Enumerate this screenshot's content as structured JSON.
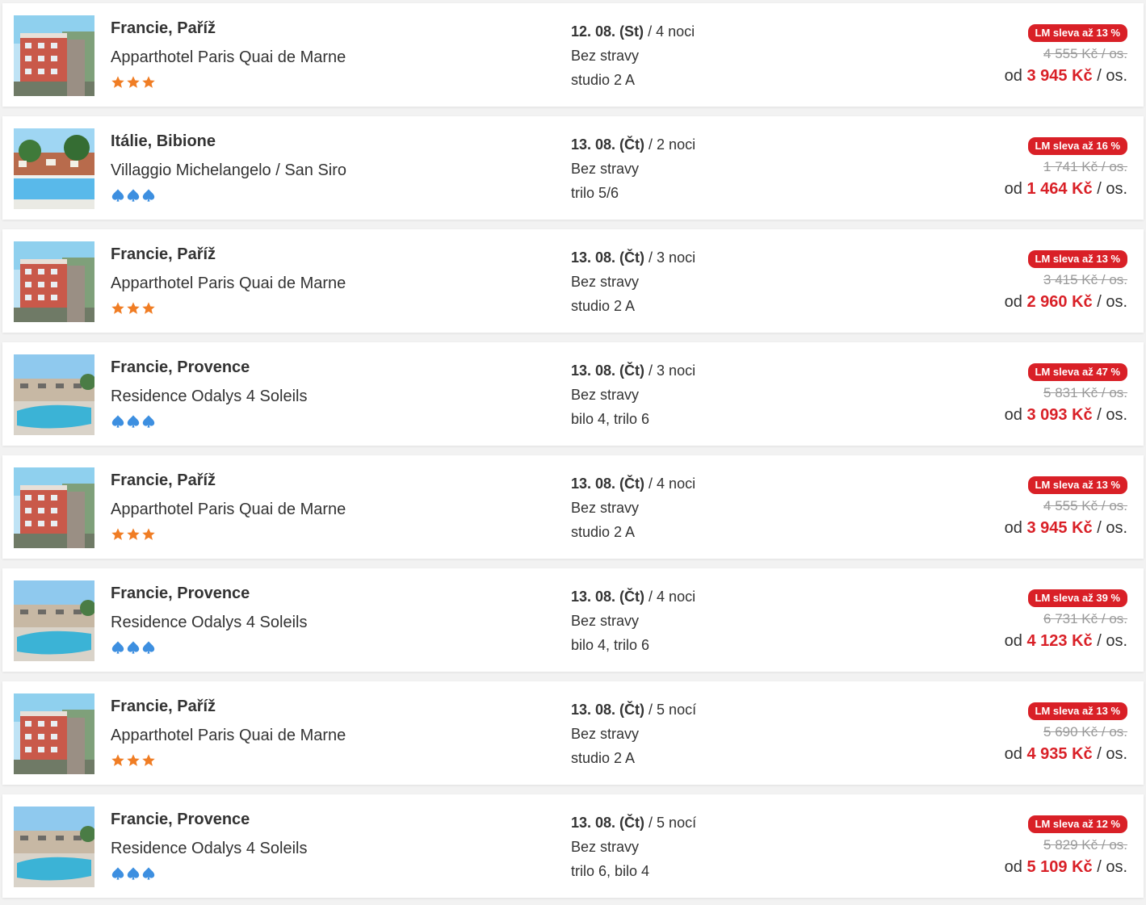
{
  "colors": {
    "accent_red": "#d92027",
    "star_orange": "#f07d24",
    "spade_blue": "#3d8fe0"
  },
  "offers": [
    {
      "location": "Francie, Paříž",
      "hotel": "Apparthotel Paris Quai de Marne",
      "rating_icon": "star-icon",
      "rating": 3,
      "thumb": "hotel-building-photo",
      "date": "12. 08. (St)",
      "nights": "/ 4 noci",
      "board": "Bez stravy",
      "room": "studio 2 A",
      "discount": "LM sleva až 13 %",
      "old_price": "4 555 Kč / os.",
      "price_prefix": "od",
      "price": "3 945 Kč",
      "price_suffix": "/ os."
    },
    {
      "location": "Itálie, Bibione",
      "hotel": "Villaggio Michelangelo / San Siro",
      "rating_icon": "spade-icon",
      "rating": 3,
      "thumb": "pool-village-photo",
      "date": "13. 08. (Čt)",
      "nights": "/ 2 noci",
      "board": "Bez stravy",
      "room": "trilo 5/6",
      "discount": "LM sleva až 16 %",
      "old_price": "1 741 Kč / os.",
      "price_prefix": "od",
      "price": "1 464 Kč",
      "price_suffix": "/ os."
    },
    {
      "location": "Francie, Paříž",
      "hotel": "Apparthotel Paris Quai de Marne",
      "rating_icon": "star-icon",
      "rating": 3,
      "thumb": "hotel-building-photo",
      "date": "13. 08. (Čt)",
      "nights": "/ 3 noci",
      "board": "Bez stravy",
      "room": "studio 2 A",
      "discount": "LM sleva až 13 %",
      "old_price": "3 415 Kč / os.",
      "price_prefix": "od",
      "price": "2 960 Kč",
      "price_suffix": "/ os."
    },
    {
      "location": "Francie, Provence",
      "hotel": "Residence Odalys 4 Soleils",
      "rating_icon": "spade-icon",
      "rating": 3,
      "thumb": "residence-pool-photo",
      "date": "13. 08. (Čt)",
      "nights": "/ 3 noci",
      "board": "Bez stravy",
      "room": "bilo 4, trilo 6",
      "discount": "LM sleva až 47 %",
      "old_price": "5 831 Kč / os.",
      "price_prefix": "od",
      "price": "3 093 Kč",
      "price_suffix": "/ os."
    },
    {
      "location": "Francie, Paříž",
      "hotel": "Apparthotel Paris Quai de Marne",
      "rating_icon": "star-icon",
      "rating": 3,
      "thumb": "hotel-building-photo",
      "date": "13. 08. (Čt)",
      "nights": "/ 4 noci",
      "board": "Bez stravy",
      "room": "studio 2 A",
      "discount": "LM sleva až 13 %",
      "old_price": "4 555 Kč / os.",
      "price_prefix": "od",
      "price": "3 945 Kč",
      "price_suffix": "/ os."
    },
    {
      "location": "Francie, Provence",
      "hotel": "Residence Odalys 4 Soleils",
      "rating_icon": "spade-icon",
      "rating": 3,
      "thumb": "residence-pool-photo",
      "date": "13. 08. (Čt)",
      "nights": "/ 4 noci",
      "board": "Bez stravy",
      "room": "bilo 4, trilo 6",
      "discount": "LM sleva až 39 %",
      "old_price": "6 731 Kč / os.",
      "price_prefix": "od",
      "price": "4 123 Kč",
      "price_suffix": "/ os."
    },
    {
      "location": "Francie, Paříž",
      "hotel": "Apparthotel Paris Quai de Marne",
      "rating_icon": "star-icon",
      "rating": 3,
      "thumb": "hotel-building-photo",
      "date": "13. 08. (Čt)",
      "nights": "/ 5 nocí",
      "board": "Bez stravy",
      "room": "studio 2 A",
      "discount": "LM sleva až 13 %",
      "old_price": "5 690 Kč / os.",
      "price_prefix": "od",
      "price": "4 935 Kč",
      "price_suffix": "/ os."
    },
    {
      "location": "Francie, Provence",
      "hotel": "Residence Odalys 4 Soleils",
      "rating_icon": "spade-icon",
      "rating": 3,
      "thumb": "residence-pool-photo",
      "date": "13. 08. (Čt)",
      "nights": "/ 5 nocí",
      "board": "Bez stravy",
      "room": "trilo 6, bilo 4",
      "discount": "LM sleva až 12 %",
      "old_price": "5 829 Kč / os.",
      "price_prefix": "od",
      "price": "5 109 Kč",
      "price_suffix": "/ os."
    }
  ]
}
